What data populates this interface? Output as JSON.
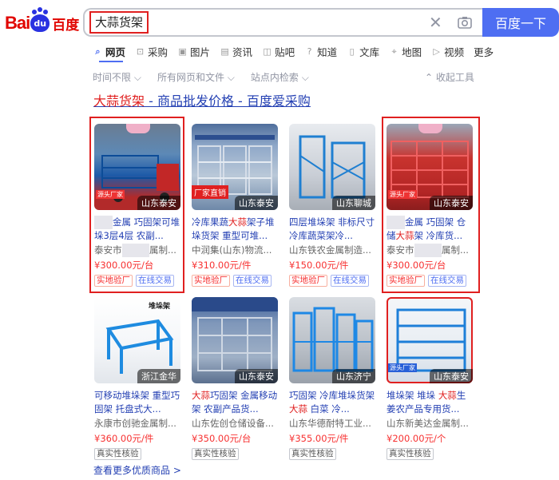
{
  "header": {
    "logo_text_en": "Bai",
    "logo_paw": "du",
    "logo_text_cn": "百度",
    "query": "大蒜货架",
    "search_button": "百度一下",
    "clear_icon": "close-icon",
    "camera_icon": "camera-icon"
  },
  "tabs": [
    {
      "label": "网页",
      "icon": "search-icon"
    },
    {
      "label": "采购",
      "icon": "cart-icon"
    },
    {
      "label": "图片",
      "icon": "image-icon"
    },
    {
      "label": "资讯",
      "icon": "news-icon"
    },
    {
      "label": "贴吧",
      "icon": "tieba-icon"
    },
    {
      "label": "知道",
      "icon": "question-icon"
    },
    {
      "label": "文库",
      "icon": "doc-icon"
    },
    {
      "label": "地图",
      "icon": "map-icon"
    },
    {
      "label": "视频",
      "icon": "video-icon"
    },
    {
      "label": "更多",
      "icon": ""
    }
  ],
  "filters": {
    "time": "时间不限",
    "type": "所有网页和文件",
    "site": "站点内检索",
    "collapse": "收起工具"
  },
  "result": {
    "title_highlight": "大蒜货架",
    "title_rest": " - 商品批发价格 - 百度爱采购"
  },
  "products": [
    {
      "name_a": "金属 巧固架可堆垛3层4层 农副...",
      "name_hl": "",
      "name_b": "",
      "shop": "泰安市",
      "shop_b": "属制...",
      "price": "¥300.00元/台",
      "location": "山东泰安",
      "badge": "源头厂家",
      "tags": [
        "实地验厂",
        "在线交易"
      ]
    },
    {
      "name_a": "冷库果蔬",
      "name_hl": "大蒜",
      "name_b": "架子堆垛货架 重型可堆...",
      "shop": "中润集(山东)物流...",
      "shop_b": "",
      "price": "¥310.00元/件",
      "location": "山东泰安",
      "badge": "厂家直销",
      "tags": [
        "实地验厂",
        "在线交易"
      ]
    },
    {
      "name_a": "四层堆垛架 非标尺寸 冷库蔬菜架冷...",
      "name_hl": "",
      "name_b": "",
      "shop": "山东铁农金属制造...",
      "shop_b": "",
      "price": "¥150.00元/件",
      "location": "山东聊城",
      "badge": "",
      "tags": [
        "实地验厂",
        "在线交易"
      ]
    },
    {
      "name_a": "金属 巧固架 仓储",
      "name_hl": "大蒜",
      "name_b": "架 冷库货...",
      "shop": "泰安市",
      "shop_b": "属制...",
      "price": "¥300.00元/台",
      "location": "山东泰安",
      "badge": "源头厂家",
      "tags": [
        "实地验厂",
        "在线交易"
      ]
    },
    {
      "name_a": "可移动堆垛架 重型巧固架 托盘式大...",
      "name_hl": "",
      "name_b": "",
      "shop": "永康市创驰金属制...",
      "shop_b": "",
      "price": "¥360.00元/件",
      "location": "浙江金华",
      "badge": "堆垛架",
      "tags": [
        "真实性核验"
      ]
    },
    {
      "name_a": "",
      "name_hl": "大蒜",
      "name_b": "巧固架 金属移动架 农副产品货...",
      "shop": "山东佐创仓储设备...",
      "shop_b": "",
      "price": "¥350.00元/台",
      "location": "山东泰安",
      "badge": "",
      "tags": [
        "真实性核验"
      ]
    },
    {
      "name_a": "巧固架 冷库堆垛货架 ",
      "name_hl": "大蒜",
      "name_b": " 白菜 冷...",
      "shop": "山东华德耐特工业...",
      "shop_b": "",
      "price": "¥355.00元/件",
      "location": "山东济宁",
      "badge": "",
      "tags": [
        "真实性核验"
      ]
    },
    {
      "name_a": "堆垛架 堆垛 ",
      "name_hl": "大蒜",
      "name_b": "生姜农产品专用货...",
      "shop": "山东新美达金属制...",
      "shop_b": "",
      "price": "¥200.00元/个",
      "location": "山东泰安",
      "badge": "源头厂家",
      "tags": [
        "真实性核验"
      ]
    }
  ],
  "more_link": "查看更多优质商品 >",
  "colors": {
    "brand_blue": "#4e6ef2",
    "link_blue": "#2440b3",
    "price_red": "#f73131",
    "highlight_box": "#e02020"
  }
}
